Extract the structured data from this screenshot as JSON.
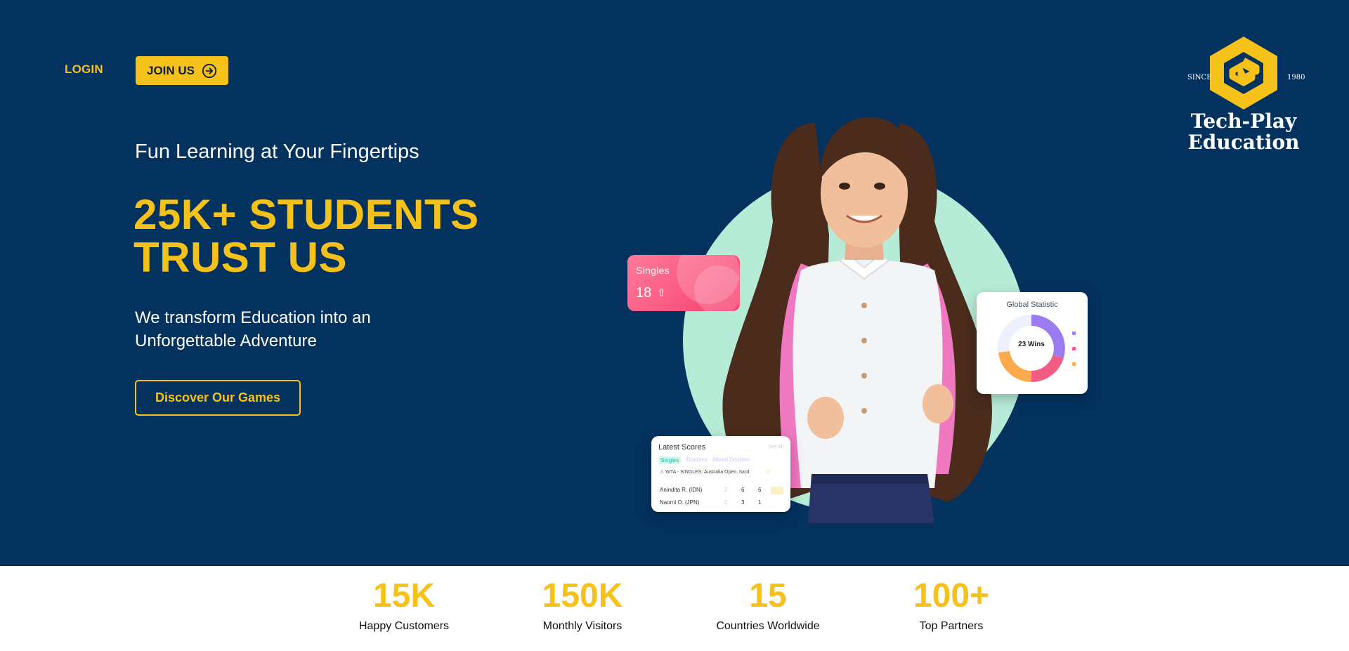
{
  "nav": {
    "login_label": "LOGIN",
    "join_label": "JOIN US"
  },
  "logo": {
    "since_left": "SINCE",
    "since_right": "1980",
    "name_line1": "Tech-Play",
    "name_line2": "Education"
  },
  "hero": {
    "tagline": "Fun Learning at Your Fingertips",
    "headline_line1": "25K+ STUDENTS",
    "headline_line2": "TRUST US",
    "sub_line1": "We transform Education into an",
    "sub_line2": "Unforgettable Adventure",
    "cta_label": "Discover Our Games"
  },
  "cards": {
    "singles": {
      "title": "Singles",
      "value": "18"
    },
    "global": {
      "title": "Global Statistic",
      "center": "23 Wins"
    },
    "scores": {
      "title": "Latest Scores",
      "see_all": "See All",
      "tabs": [
        "Singles",
        "Doubles",
        "Mixed Doubles"
      ],
      "event": "WTA - SINGLES: Australia Open, hard",
      "rows": [
        {
          "player": "Anindita R. (IDN)",
          "s1": "2",
          "s2": "6",
          "s3": "6"
        },
        {
          "player": "Naomi O. (JPN)",
          "s1": "0",
          "s2": "3",
          "s3": "1"
        }
      ]
    }
  },
  "colors": {
    "navy": "#03325f",
    "accent": "#f6c21a",
    "mint": "#b6ecd7",
    "pink": "#f7406f"
  },
  "stats": [
    {
      "value": "15K",
      "label": "Happy Customers"
    },
    {
      "value": "150K",
      "label": "Monthly Visitors"
    },
    {
      "value": "15",
      "label": "Countries Worldwide"
    },
    {
      "value": "100+",
      "label": "Top Partners"
    }
  ]
}
